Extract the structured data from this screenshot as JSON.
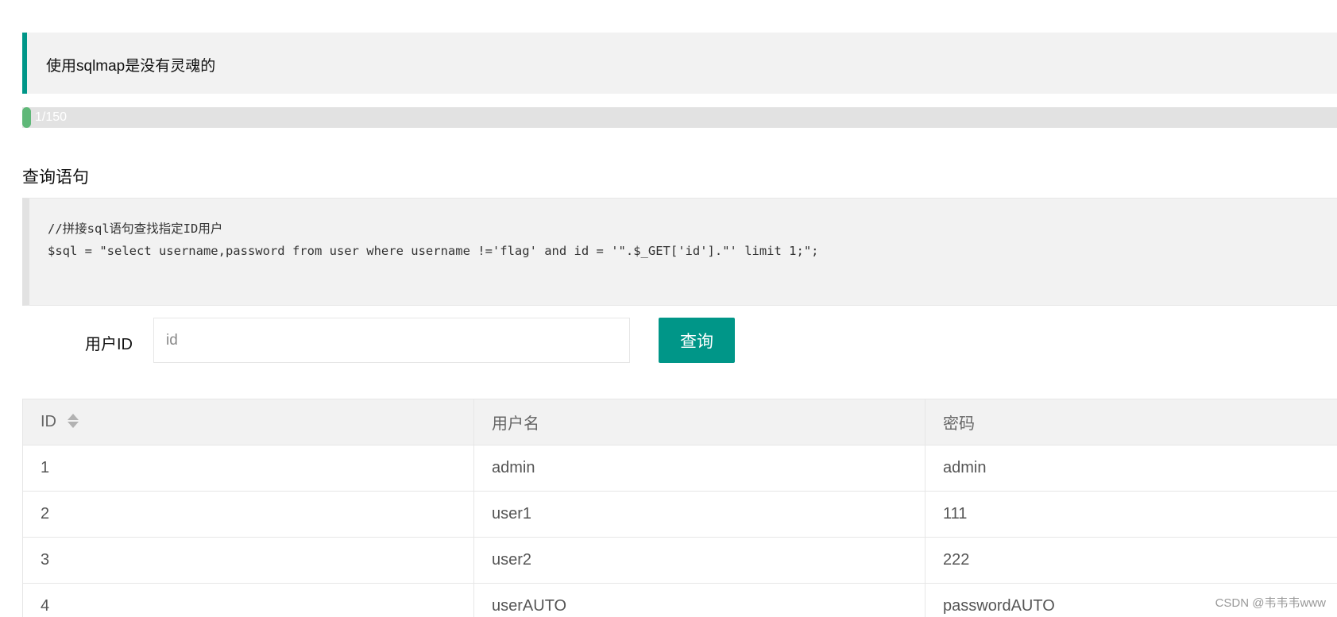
{
  "notice": {
    "text": "使用sqlmap是没有灵魂的"
  },
  "progress": {
    "label": "1/150",
    "current": 1,
    "total": 150
  },
  "section": {
    "title": "查询语句"
  },
  "code": {
    "line1": "//拼接sql语句查找指定ID用户",
    "line2": "$sql = \"select username,password from user where username !='flag' and id = '\".$_GET['id'].\"' limit 1;\";"
  },
  "form": {
    "label": "用户ID",
    "input_placeholder": "id",
    "input_value": "",
    "button_label": "查询"
  },
  "table": {
    "columns": [
      "ID",
      "用户名",
      "密码"
    ],
    "rows": [
      [
        "1",
        "admin",
        "admin"
      ],
      [
        "2",
        "user1",
        "111"
      ],
      [
        "3",
        "user2",
        "222"
      ],
      [
        "4",
        "userAUTO",
        "passwordAUTO"
      ]
    ]
  },
  "watermark": {
    "text": "CSDN @韦韦韦www"
  },
  "colors": {
    "accent": "#009688",
    "progress": "#5fb878"
  }
}
